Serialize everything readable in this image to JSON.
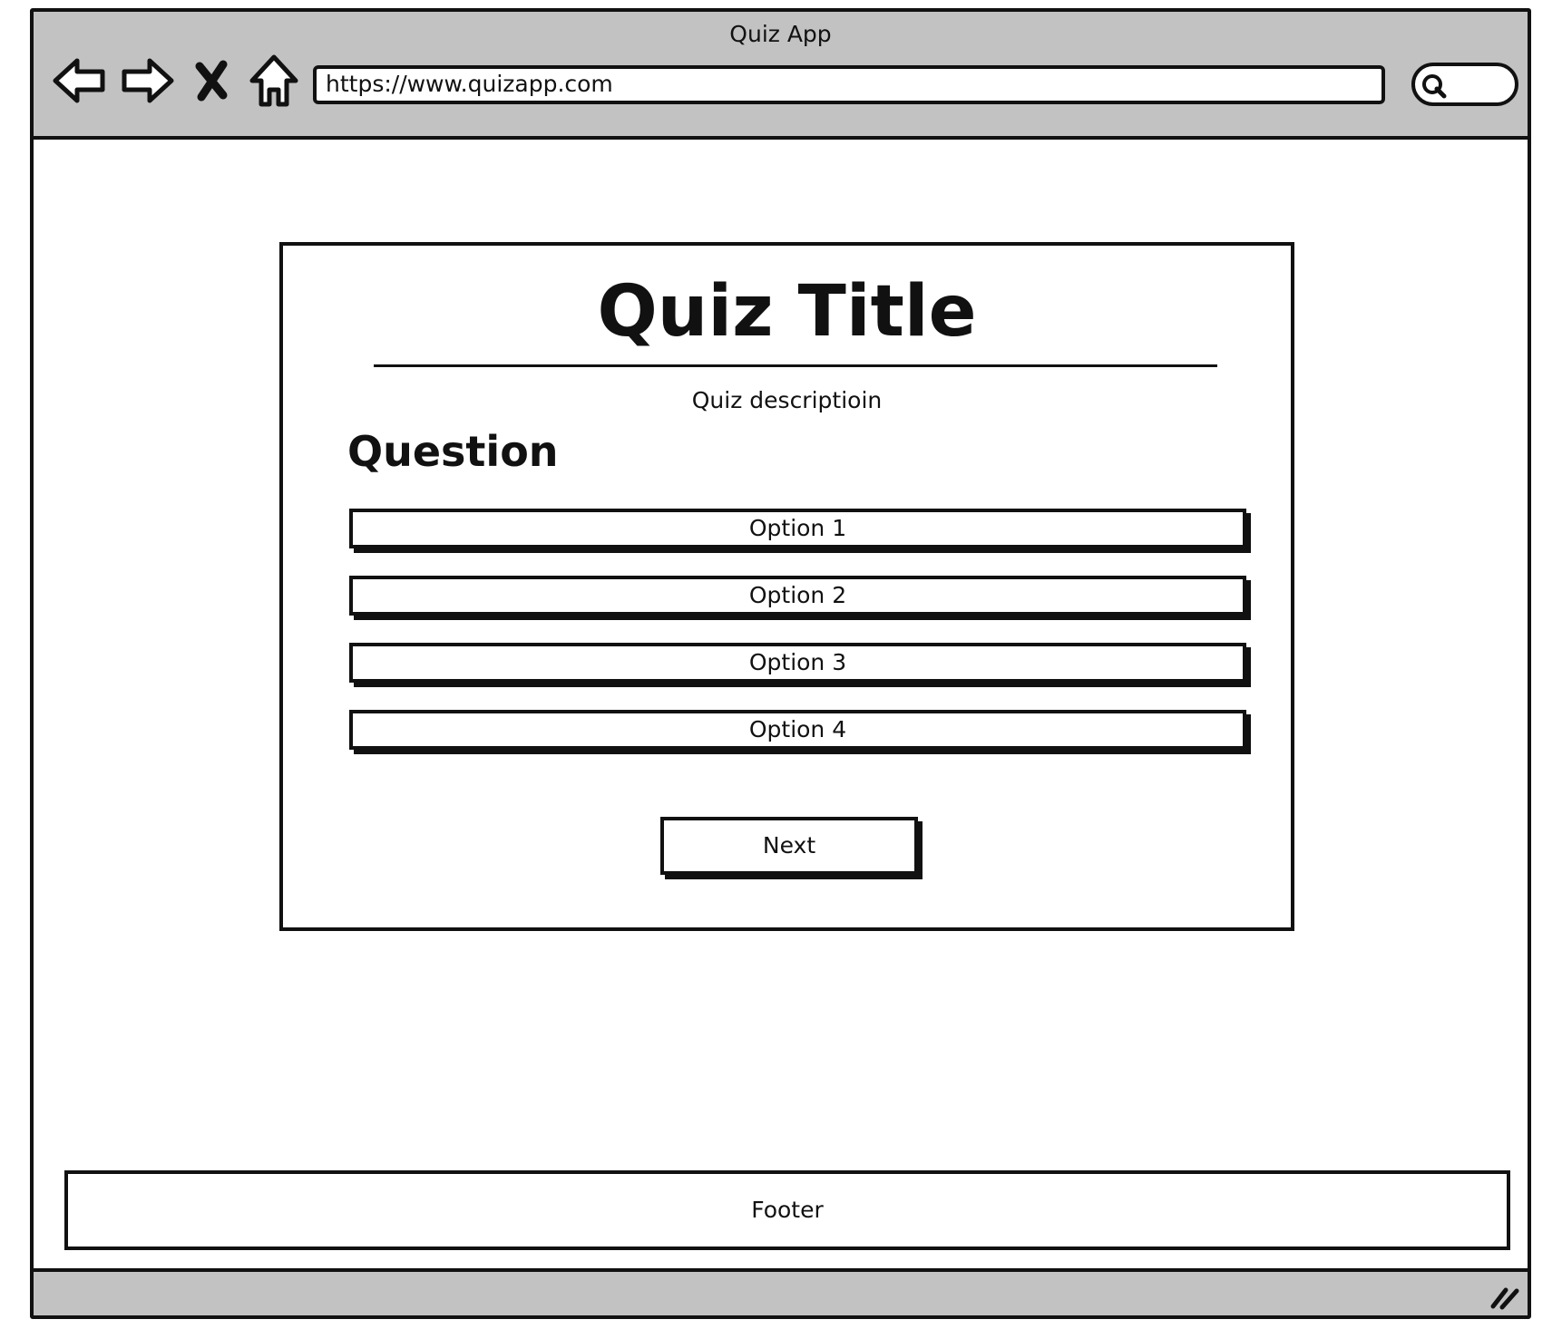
{
  "window": {
    "title": "Quiz App"
  },
  "toolbar": {
    "url": "https://www.quizapp.com",
    "icons": [
      "back-arrow-icon",
      "forward-arrow-icon",
      "close-x-icon",
      "home-icon",
      "search-icon"
    ]
  },
  "quiz": {
    "title": "Quiz Title",
    "description": "Quiz descriptioin",
    "question": "Question",
    "options": [
      "Option 1",
      "Option 2",
      "Option 3",
      "Option 4"
    ],
    "next_label": "Next"
  },
  "footer": {
    "label": "Footer"
  },
  "colors": {
    "chrome": "#c2c2c2",
    "ink": "#111111",
    "background": "#ffffff"
  }
}
